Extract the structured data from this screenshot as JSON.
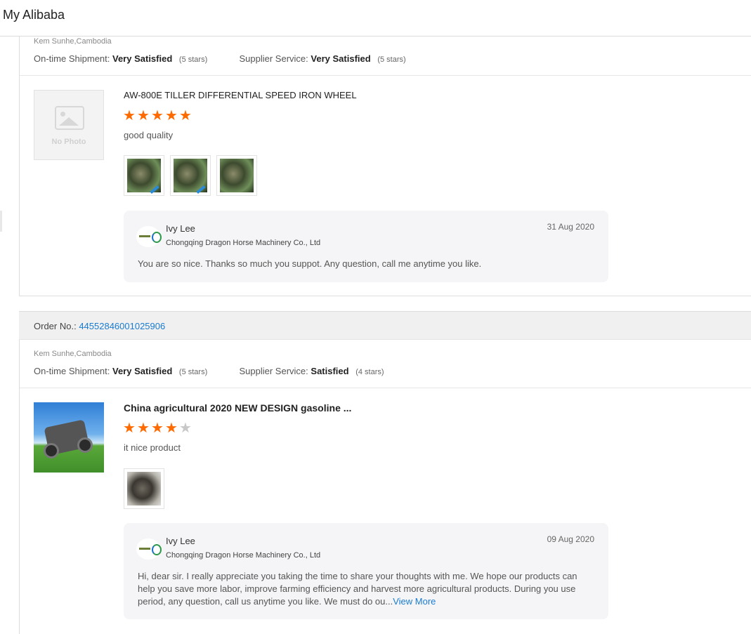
{
  "header": {
    "title": "My Alibaba"
  },
  "reviews": [
    {
      "location": "Kem Sunhe,Cambodia",
      "shipment_label": "On-time Shipment:",
      "shipment_value": "Very Satisfied",
      "shipment_stars": "(5 stars)",
      "service_label": "Supplier Service:",
      "service_value": "Very Satisfied",
      "service_stars": "(5 stars)",
      "product_image": "no-photo",
      "no_photo_text": "No Photo",
      "product_title": "AW-800E TILLER DIFFERENTIAL SPEED IRON WHEEL",
      "rating": 5,
      "comment": "good quality",
      "photos": [
        "tiller-wheel-photo",
        "tiller-wheel-photo",
        "tiller-wheel-photo"
      ],
      "reply": {
        "name": "Ivy Lee",
        "company": "Chongqing Dragon Horse Machinery Co., Ltd",
        "date": "31 Aug 2020",
        "text": "You are so nice. Thanks so much you suppot. Any question, call me anytime you like."
      }
    },
    {
      "order_label": "Order No.:",
      "order_number": "44552846001025906",
      "location": "Kem Sunhe,Cambodia",
      "shipment_label": "On-time Shipment:",
      "shipment_value": "Very Satisfied",
      "shipment_stars": "(5 stars)",
      "service_label": "Supplier Service:",
      "service_value": "Satisfied",
      "service_stars": "(4 stars)",
      "product_image": "tiller-product-photo",
      "product_title": "China agricultural 2020 NEW DESIGN gasoline ...",
      "rating": 4,
      "comment": "it nice product",
      "photos": [
        "tiller-part-photo"
      ],
      "reply": {
        "name": "Ivy Lee",
        "company": "Chongqing Dragon Horse Machinery Co., Ltd",
        "date": "09 Aug 2020",
        "text": "Hi, dear sir. I really appreciate you taking the time to share your thoughts with me. We hope our products can help you save more labor, improve farming efficiency and harvest more agricultural products. During you use period, any question, call us anytime you like. We must do ou...",
        "view_more": "View More"
      }
    }
  ],
  "colors": {
    "star_on": "#ff6a00",
    "star_off": "#c8c8c8",
    "link": "#1a7bd0"
  },
  "icons": {
    "star": "star-icon",
    "supplier_logo": "supplier-logo-icon"
  }
}
